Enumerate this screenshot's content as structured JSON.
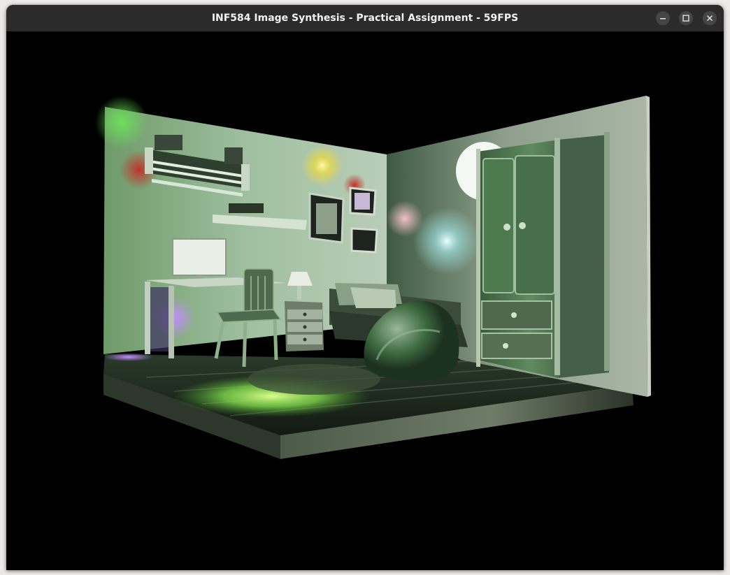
{
  "window": {
    "title": "INF584 Image Synthesis - Practical Assignment - 59FPS",
    "controls": {
      "minimize_icon": "minimize-icon",
      "maximize_icon": "maximize-icon",
      "close_icon": "close-icon"
    }
  },
  "viewport": {
    "background": "#000000",
    "scene": "3D rendered bedroom"
  },
  "colors": {
    "titlebar": "#2b2b2b",
    "title_text": "#f2f2f2",
    "scene_tint": "#7fa07a"
  }
}
